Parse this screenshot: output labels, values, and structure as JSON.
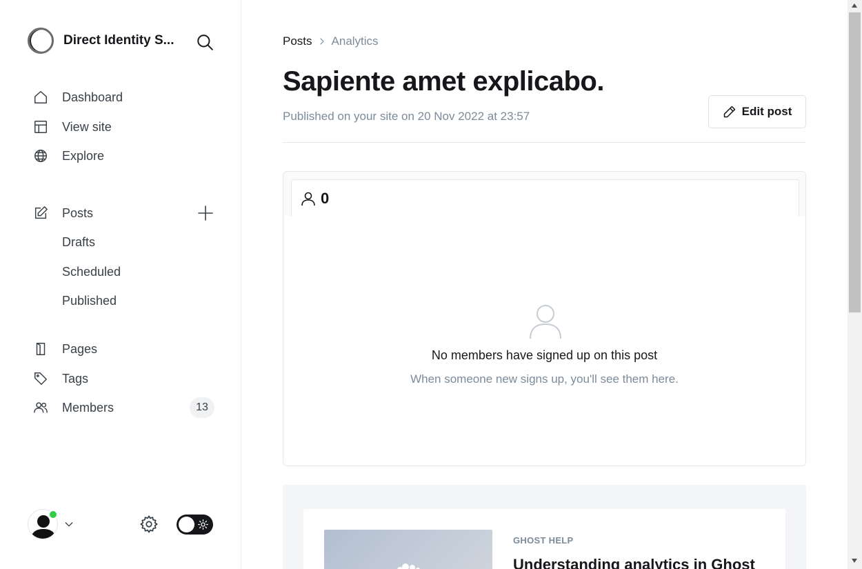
{
  "sidebar": {
    "site_name": "Direct Identity S...",
    "nav": {
      "dashboard": "Dashboard",
      "view_site": "View site",
      "explore": "Explore",
      "posts": "Posts",
      "drafts": "Drafts",
      "scheduled": "Scheduled",
      "published": "Published",
      "pages": "Pages",
      "tags": "Tags",
      "members": "Members",
      "members_count": "13"
    },
    "icons": [
      "search-icon",
      "home-icon",
      "layout-icon",
      "globe-icon",
      "edit-icon",
      "plus-icon",
      "page-icon",
      "tag-icon",
      "members-icon",
      "settings-icon",
      "sun-icon",
      "chevron-down-icon"
    ],
    "online_color": "#30cf43"
  },
  "breadcrumb": {
    "parent": "Posts",
    "current": "Analytics"
  },
  "post": {
    "title": "Sapiente amet explicabo.",
    "meta": "Published on your site on 20 Nov 2022 at 23:57",
    "edit_label": "Edit post"
  },
  "members_card": {
    "count": "0",
    "empty_title": "No members have signed up on this post",
    "empty_subtitle": "When someone new signs up, you'll see them here."
  },
  "help": {
    "eyebrow": "GHOST HELP",
    "title": "Understanding analytics in Ghost"
  },
  "colors": {
    "text": "#15171a",
    "muted": "#7c8b9a",
    "border": "#e6e9eb"
  }
}
